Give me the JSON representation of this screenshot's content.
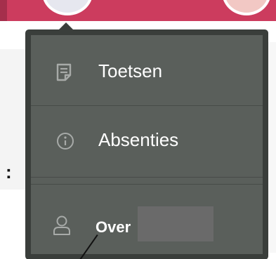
{
  "header": {
    "brand_color": "#cc3c5e"
  },
  "menu": {
    "background": "#3a3e3b",
    "items": [
      {
        "label": "Toetsen",
        "icon": "document-icon"
      },
      {
        "label": "Absenties",
        "icon": "info-icon"
      },
      {
        "label": "Over",
        "icon": "user-icon"
      }
    ]
  },
  "background": {
    "partial_text": ":"
  }
}
